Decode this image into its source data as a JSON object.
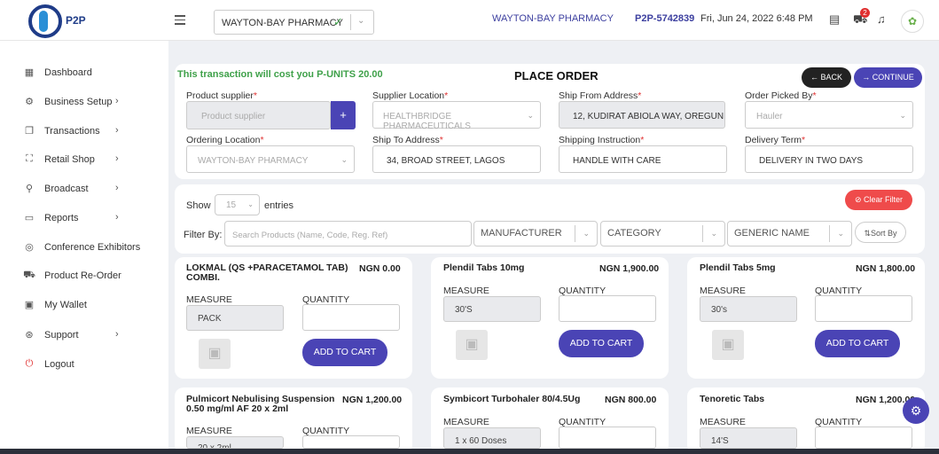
{
  "header": {
    "logo_text": "P2P",
    "pharmacy_select": "WAYTON-BAY PHARMACY",
    "pharmacy_name": "WAYTON-BAY PHARMACY",
    "account_code": "P2P-5742839",
    "datetime": "Fri, Jun 24, 2022 6:48 PM",
    "cart_count": "2"
  },
  "sidebar": {
    "items": [
      {
        "label": "Dashboard",
        "icon": "grid-icon",
        "has_arrow": false
      },
      {
        "label": "Business Setup",
        "icon": "gear-icon",
        "has_arrow": true
      },
      {
        "label": "Transactions",
        "icon": "copy-icon",
        "has_arrow": true
      },
      {
        "label": "Retail Shop",
        "icon": "frame-icon",
        "has_arrow": true
      },
      {
        "label": "Broadcast",
        "icon": "mic-icon",
        "has_arrow": true
      },
      {
        "label": "Reports",
        "icon": "folder-icon",
        "has_arrow": true
      },
      {
        "label": "Conference Exhibitors",
        "icon": "target-icon",
        "has_arrow": false
      },
      {
        "label": "Product Re-Order",
        "icon": "cart-icon",
        "has_arrow": false
      },
      {
        "label": "My Wallet",
        "icon": "wallet-icon",
        "has_arrow": false
      },
      {
        "label": "Support",
        "icon": "lifebuoy-icon",
        "has_arrow": true
      },
      {
        "label": "Logout",
        "icon": "power-icon",
        "has_arrow": false
      }
    ]
  },
  "order": {
    "cost_text": "This transaction will cost you P-UNITS 20.00",
    "title": "PLACE ORDER",
    "back_label": "BACK",
    "continue_label": "CONTINUE",
    "fields": {
      "product_supplier": {
        "label": "Product supplier",
        "placeholder": "Product supplier"
      },
      "supplier_location": {
        "label": "Supplier Location",
        "value": "HEALTHBRIDGE PHARMACEUTICALS"
      },
      "ship_from": {
        "label": "Ship From Address",
        "value": "12, KUDIRAT ABIOLA WAY, OREGUN"
      },
      "order_picked_by": {
        "label": "Order Picked By",
        "value": "Hauler"
      },
      "ordering_location": {
        "label": "Ordering Location",
        "value": "WAYTON-BAY PHARMACY"
      },
      "ship_to": {
        "label": "Ship To Address",
        "value": "34, BROAD STREET, LAGOS"
      },
      "shipping_instruction": {
        "label": "Shipping Instruction",
        "value": "HANDLE WITH CARE"
      },
      "delivery_term": {
        "label": "Delivery Term",
        "value": "DELIVERY IN TWO DAYS"
      }
    }
  },
  "filters": {
    "show_label": "Show",
    "entries_value": "15",
    "entries_label": "entries",
    "clear_filter": "Clear Filter",
    "filter_by": "Filter By:",
    "search_placeholder": "Search Products (Name, Code, Reg. Ref)",
    "manufacturer": "MANUFACTURER",
    "category": "CATEGORY",
    "generic_name": "GENERIC NAME",
    "sort_by": "Sort By"
  },
  "products": [
    {
      "name_l1": "LOKMAL (QS +PARACETAMOL TAB)",
      "name_l2": "COMBI.",
      "price": "NGN 0.00",
      "measure": "PACK",
      "add_label": "ADD TO CART"
    },
    {
      "name_l1": "Plendil Tabs 10mg",
      "name_l2": "",
      "price": "NGN 1,900.00",
      "measure": "30'S",
      "add_label": "ADD TO CART"
    },
    {
      "name_l1": "Plendil Tabs 5mg",
      "name_l2": "",
      "price": "NGN 1,800.00",
      "measure": "30's",
      "add_label": "ADD TO CART"
    },
    {
      "name_l1": "Pulmicort Nebulising Suspension",
      "name_l2": "0.50 mg/ml AF 20 x 2ml",
      "price": "NGN 1,200.00",
      "measure": "20 x 2ml"
    },
    {
      "name_l1": "Symbicort Turbohaler 80/4.5Ug",
      "name_l2": "",
      "price": "NGN 800.00",
      "measure": "1 x 60 Doses"
    },
    {
      "name_l1": "Tenoretic Tabs",
      "name_l2": "",
      "price": "NGN 1,200.00",
      "measure": "14'S"
    }
  ],
  "labels": {
    "measure": "MEASURE",
    "quantity": "QUANTITY"
  }
}
